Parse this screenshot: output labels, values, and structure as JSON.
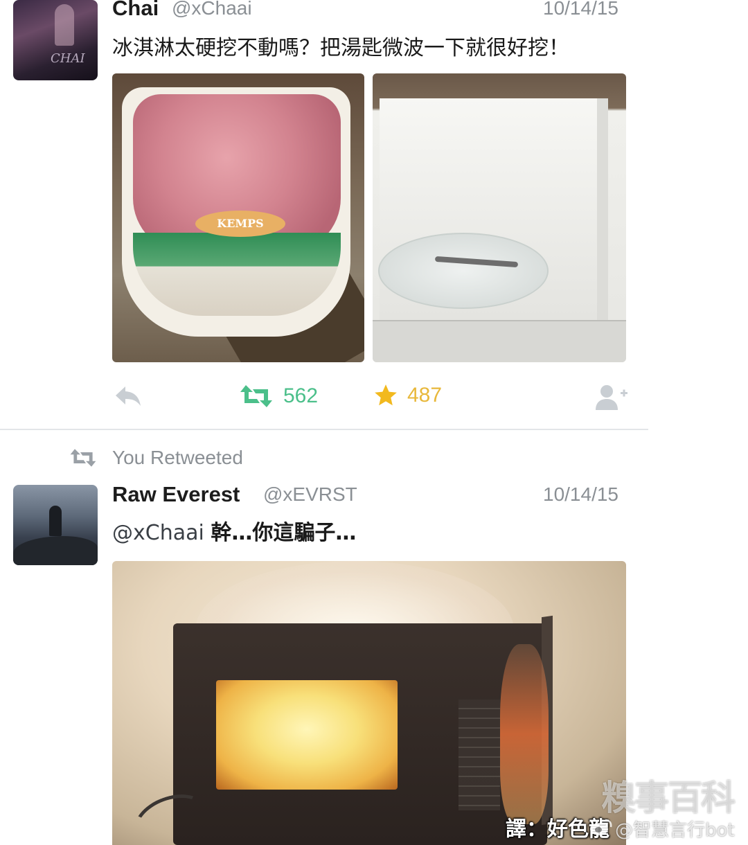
{
  "tweet1": {
    "name": "Chai",
    "handle": "@xChaai",
    "date": "10/14/15",
    "text": "冰淇淋太硬挖不動嗎？把湯匙微波一下就很好挖！",
    "avatar_text": "CHAI",
    "image1_label": "KEMPS",
    "retweet_count": "562",
    "favorite_count": "487"
  },
  "retweet_context": {
    "label": "You Retweeted"
  },
  "tweet2": {
    "name": "Raw Everest",
    "handle": "@xEVRST",
    "date": "10/14/15",
    "mention": "@xChaai",
    "text": "幹…你這騙子…",
    "subtitle": "譯：好色龍"
  },
  "watermark": {
    "logo": "糗事百科",
    "handle": "@智慧言行bot"
  },
  "colors": {
    "retweet_green": "#4bbf8a",
    "favorite_gold": "#e8b83b",
    "meta_gray": "#8a8f94"
  },
  "icons": {
    "reply": "reply-icon",
    "retweet": "retweet-icon",
    "favorite": "star-icon",
    "follow": "follow-icon",
    "weibo": "weibo-icon"
  }
}
